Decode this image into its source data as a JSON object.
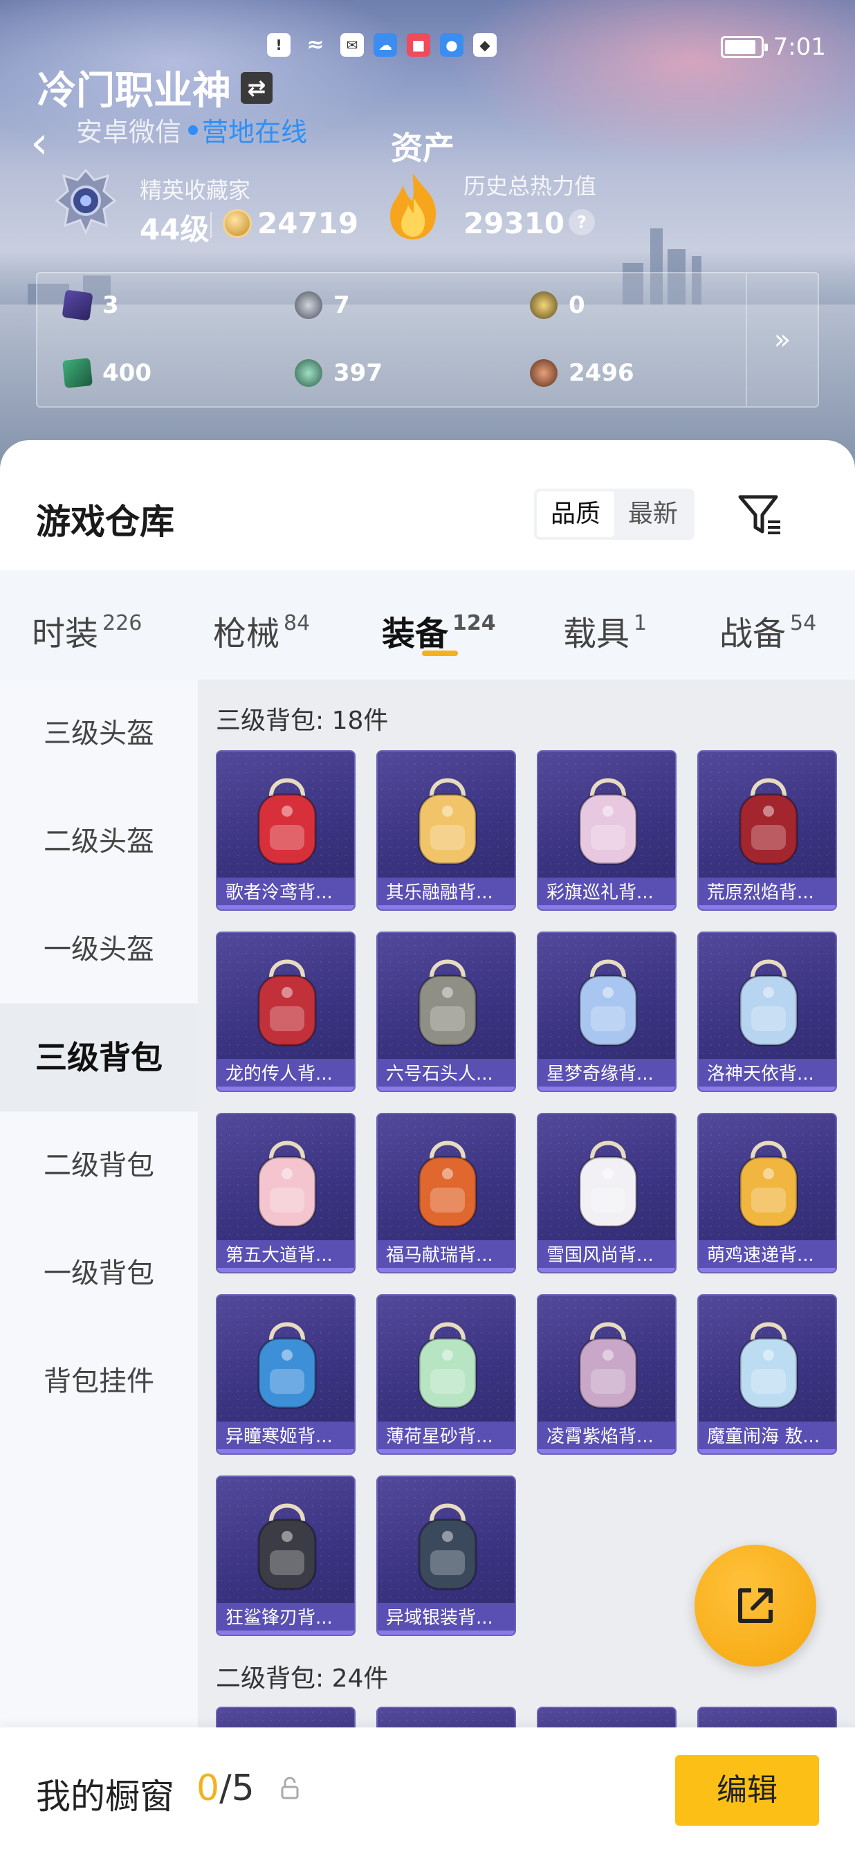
{
  "status_bar": {
    "time": "7:01",
    "network": "6"
  },
  "profile": {
    "name": "冷门职业神",
    "platform": "安卓微信",
    "online_status": "营地在线"
  },
  "assets": {
    "title": "资产",
    "rank_title": "精英收藏家",
    "level": "44级",
    "coins": "24719",
    "heat_label": "历史总热力值",
    "heat_value": "29310",
    "help": "?"
  },
  "resources": [
    {
      "value": "3",
      "icon": "purple-card-icon"
    },
    {
      "value": "7",
      "icon": "silver-coin-icon"
    },
    {
      "value": "0",
      "icon": "gold-coin-icon"
    },
    {
      "value": "400",
      "icon": "green-card-icon"
    },
    {
      "value": "397",
      "icon": "green-orb-icon"
    },
    {
      "value": "2496",
      "icon": "bronze-coin-icon"
    }
  ],
  "warehouse": {
    "title": "游戏仓库",
    "sort_quality": "品质",
    "sort_newest": "最新"
  },
  "tabs": [
    {
      "label": "时装",
      "count": "226"
    },
    {
      "label": "枪械",
      "count": "84"
    },
    {
      "label": "装备",
      "count": "124"
    },
    {
      "label": "载具",
      "count": "1"
    },
    {
      "label": "战备",
      "count": "54"
    }
  ],
  "sidebar": [
    {
      "label": "三级头盔"
    },
    {
      "label": "二级头盔"
    },
    {
      "label": "一级头盔"
    },
    {
      "label": "三级背包"
    },
    {
      "label": "二级背包"
    },
    {
      "label": "一级背包"
    },
    {
      "label": "背包挂件"
    }
  ],
  "sections": {
    "level3_title": "三级背包: 18件",
    "level2_title": "二级背包: 24件"
  },
  "items": [
    {
      "name": "歌者泠鸢背...",
      "color": "#d8303a"
    },
    {
      "name": "其乐融融背...",
      "color": "#f2c46a"
    },
    {
      "name": "彩旗巡礼背...",
      "color": "#e8c8e0"
    },
    {
      "name": "荒原烈焰背...",
      "color": "#a3262e"
    },
    {
      "name": "龙的传人背...",
      "color": "#c2303a"
    },
    {
      "name": "六号石头人...",
      "color": "#8f8f86"
    },
    {
      "name": "星梦奇缘背...",
      "color": "#a9c6f0"
    },
    {
      "name": "洛神天依背...",
      "color": "#b7d4f0"
    },
    {
      "name": "第五大道背...",
      "color": "#f4c4cf"
    },
    {
      "name": "福马献瑞背...",
      "color": "#e0672e"
    },
    {
      "name": "雪国风尚背...",
      "color": "#f2f0f4"
    },
    {
      "name": "萌鸡速递背...",
      "color": "#f0b640"
    },
    {
      "name": "异瞳寒姬背...",
      "color": "#3d8fd8"
    },
    {
      "name": "薄荷星砂背...",
      "color": "#b7e4c2"
    },
    {
      "name": "凌霄紫焰背...",
      "color": "#c9a7c8"
    },
    {
      "name": "魔童闹海 敖...",
      "color": "#bcdcf2"
    },
    {
      "name": "狂鲨锋刃背...",
      "color": "#3c3c46"
    },
    {
      "name": "异域银装背...",
      "color": "#3a4a5c"
    }
  ],
  "showcase": {
    "label": "我的橱窗",
    "current": "0",
    "total": "/5",
    "edit": "编辑"
  },
  "colors": {
    "accent": "#f3b21c",
    "card_bg": "#3a3380",
    "link": "#2f8ff5"
  }
}
